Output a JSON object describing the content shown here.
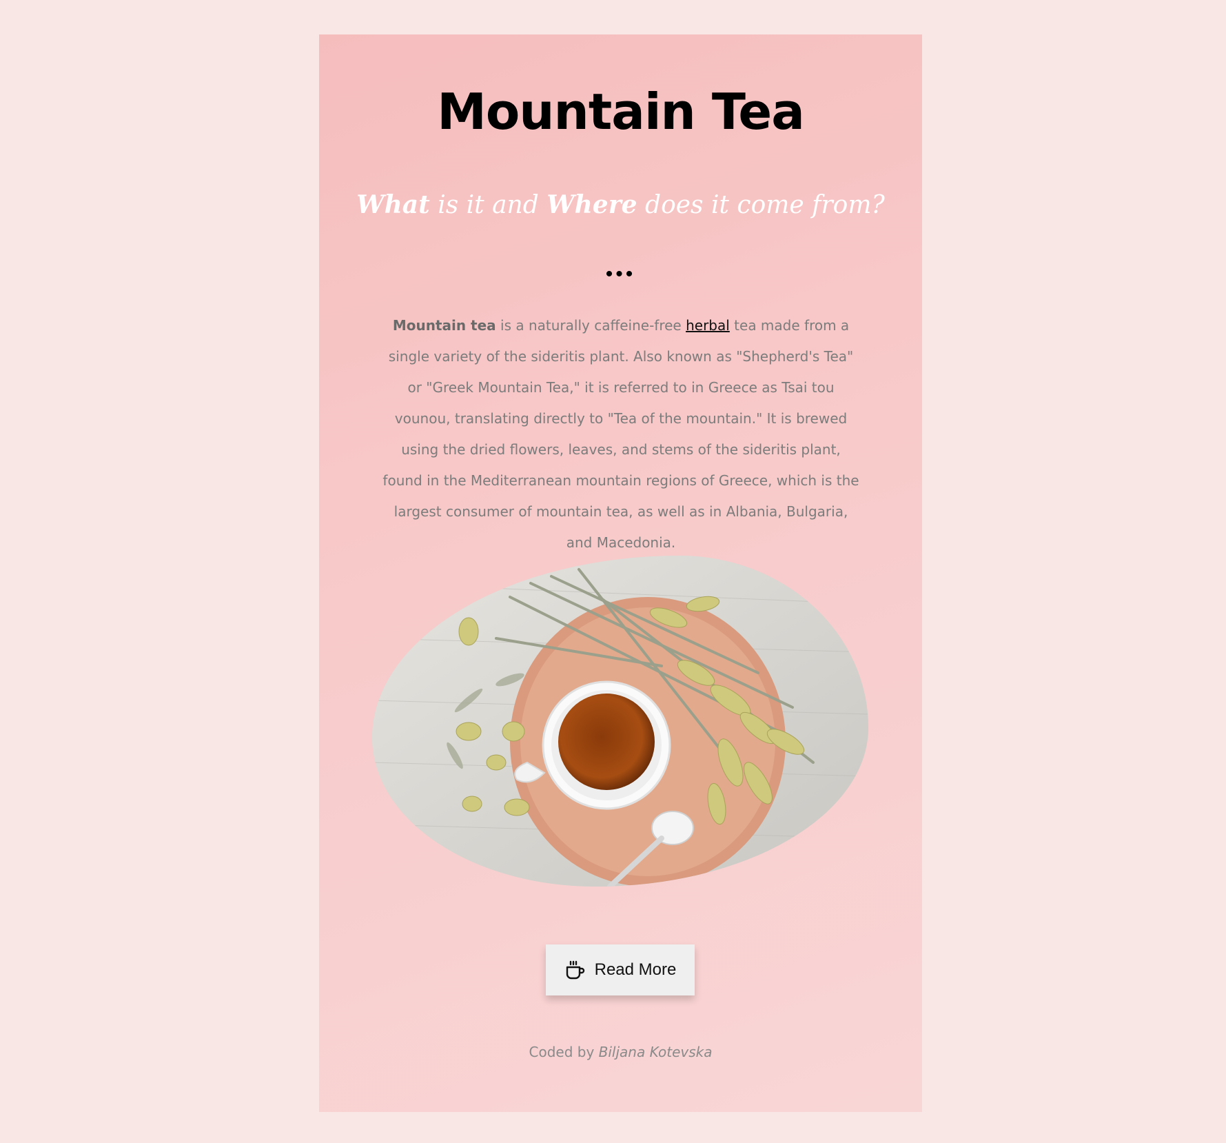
{
  "page": {
    "title": "Mountain Tea",
    "subtitle": {
      "part1": "What",
      "part2": " is it and ",
      "part3": "Where",
      "part4": " does it come from?"
    },
    "dots": "•••",
    "body": {
      "bold_lead": "Mountain tea",
      "text_before_link": " is a naturally caffeine-free ",
      "link_text": "herbal",
      "text_after_link": " tea made from a single variety of the sideritis plant. Also known as \"Shepherd's Tea\" or \"Greek Mountain Tea,\" it is referred to in Greece as Tsai tou vounou, translating directly to \"Tea of the mountain.\" It is brewed using the dried flowers, leaves, and stems of the sideritis plant, found in the Mediterranean mountain regions of Greece, which is the largest consumer of mountain tea, as well as in Albania, Bulgaria, and Macedonia."
    },
    "button": {
      "label": "Read More",
      "icon": "coffee-cup-icon"
    },
    "credit": {
      "prefix": "Coded by ",
      "author": "Biljana Kotevska"
    }
  },
  "colors": {
    "page_background": "#f9e7e5",
    "card_background": "#f7c4c4",
    "title": "#000000",
    "subtitle": "#ffffff",
    "body_text": "#7c7c7c",
    "button_background": "#efefef"
  }
}
